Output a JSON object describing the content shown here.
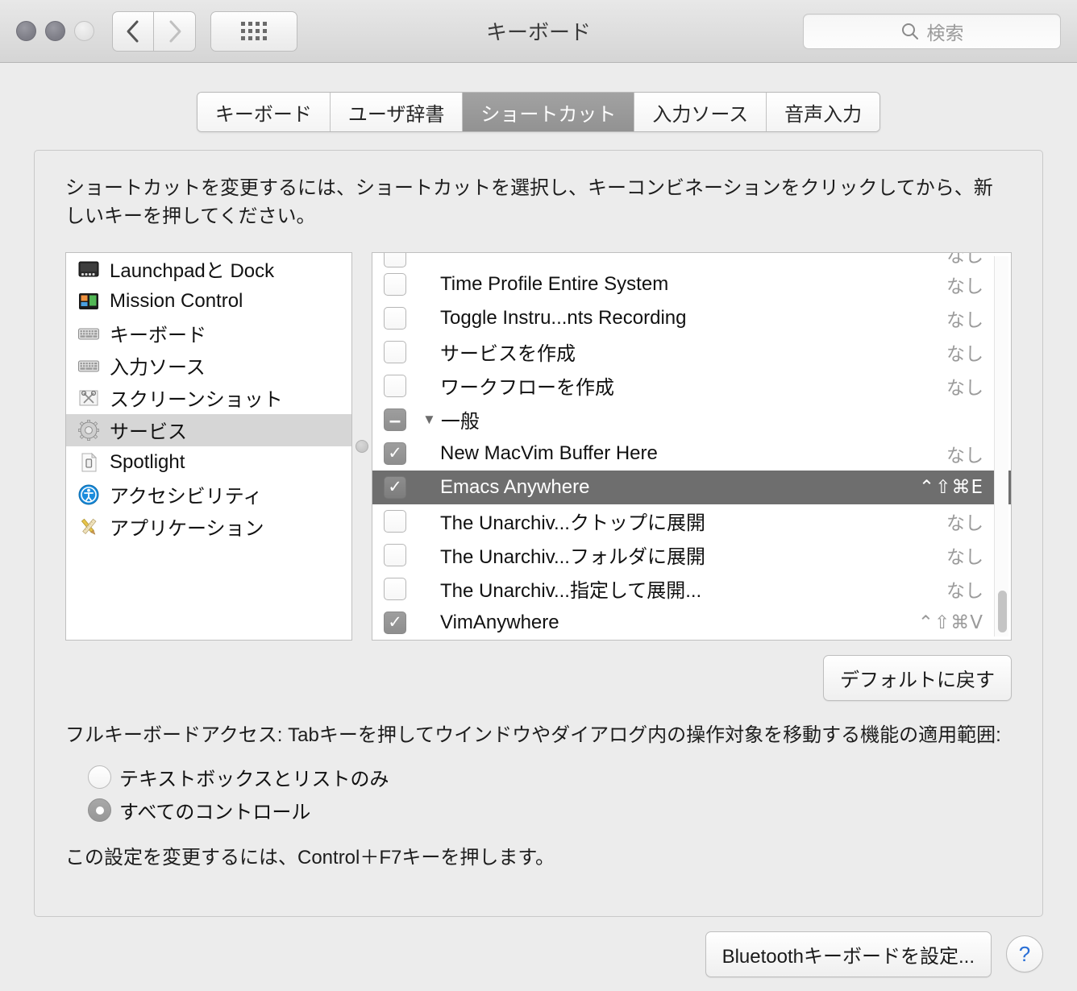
{
  "window": {
    "title": "キーボード",
    "traffic_lights": [
      "close",
      "minimize",
      "zoom"
    ],
    "nav": {
      "back": "‹",
      "forward": "›"
    },
    "grid_button": "all-preferences",
    "search": {
      "placeholder": "検索",
      "value": ""
    }
  },
  "tabs": [
    {
      "label": "キーボード",
      "selected": false
    },
    {
      "label": "ユーザ辞書",
      "selected": false
    },
    {
      "label": "ショートカット",
      "selected": true
    },
    {
      "label": "入力ソース",
      "selected": false
    },
    {
      "label": "音声入力",
      "selected": false
    }
  ],
  "description": "ショートカットを変更するには、ショートカットを選択し、キーコンビネーションをクリックしてから、新しいキーを押してください。",
  "sidebar": {
    "items": [
      {
        "label": "Launchpadと Dock",
        "icon": "launchpad-dock-icon",
        "selected": false
      },
      {
        "label": "Mission Control",
        "icon": "mission-control-icon",
        "selected": false
      },
      {
        "label": "キーボード",
        "icon": "keyboard-icon",
        "selected": false
      },
      {
        "label": "入力ソース",
        "icon": "input-sources-icon",
        "selected": false
      },
      {
        "label": "スクリーンショット",
        "icon": "screenshot-icon",
        "selected": false
      },
      {
        "label": "サービス",
        "icon": "services-gear-icon",
        "selected": true
      },
      {
        "label": "Spotlight",
        "icon": "spotlight-icon",
        "selected": false
      },
      {
        "label": "アクセシビリティ",
        "icon": "accessibility-icon",
        "selected": false
      },
      {
        "label": "アプリケーション",
        "icon": "applications-icon",
        "selected": false
      }
    ]
  },
  "shortcut_list": {
    "none_label": "なし",
    "rows": [
      {
        "type": "item",
        "label": "",
        "shortcut": "なし",
        "checked": false,
        "selected": false,
        "clipped": true
      },
      {
        "type": "item",
        "label": "Time Profile Entire System",
        "shortcut": "なし",
        "checked": false,
        "selected": false
      },
      {
        "type": "item",
        "label": "Toggle Instru...nts Recording",
        "shortcut": "なし",
        "checked": false,
        "selected": false
      },
      {
        "type": "item",
        "label": "サービスを作成",
        "shortcut": "なし",
        "checked": false,
        "selected": false
      },
      {
        "type": "item",
        "label": "ワークフローを作成",
        "shortcut": "なし",
        "checked": false,
        "selected": false
      },
      {
        "type": "group",
        "label": "一般",
        "shortcut": "",
        "state": "mixed",
        "expanded": true,
        "selected": false
      },
      {
        "type": "item",
        "label": "New MacVim Buffer Here",
        "shortcut": "なし",
        "checked": true,
        "selected": false
      },
      {
        "type": "item",
        "label": "Emacs Anywhere",
        "shortcut": "⌃⇧⌘E",
        "checked": true,
        "selected": true
      },
      {
        "type": "item",
        "label": "The Unarchiv...クトップに展開",
        "shortcut": "なし",
        "checked": false,
        "selected": false
      },
      {
        "type": "item",
        "label": "The Unarchiv...フォルダに展開",
        "shortcut": "なし",
        "checked": false,
        "selected": false
      },
      {
        "type": "item",
        "label": "The Unarchiv...指定して展開...",
        "shortcut": "なし",
        "checked": false,
        "selected": false
      },
      {
        "type": "item",
        "label": "VimAnywhere",
        "shortcut": "⌃⇧⌘V",
        "checked": true,
        "selected": false
      }
    ],
    "scrollbar": {
      "thumb_top_pct": 88,
      "thumb_height_pct": 11
    }
  },
  "buttons": {
    "restore_defaults": "デフォルトに戻す",
    "setup_bluetooth_keyboard": "Bluetoothキーボードを設定...",
    "help": "?"
  },
  "full_keyboard_access": {
    "description": "フルキーボードアクセス: Tabキーを押してウインドウやダイアログ内の操作対象を移動する機能の適用範囲:",
    "options": [
      {
        "label": "テキストボックスとリストのみ",
        "selected": false
      },
      {
        "label": "すべてのコントロール",
        "selected": true
      }
    ],
    "note": "この設定を変更するには、Control＋F7キーを押します。"
  },
  "colors": {
    "selection_row": "#6e6e6e",
    "sidebar_selection": "#d6d6d6",
    "tab_selected": "#929292",
    "window_bg": "#ececec",
    "help_blue": "#2a6fd6",
    "muted_text": "#9b9b9b"
  }
}
